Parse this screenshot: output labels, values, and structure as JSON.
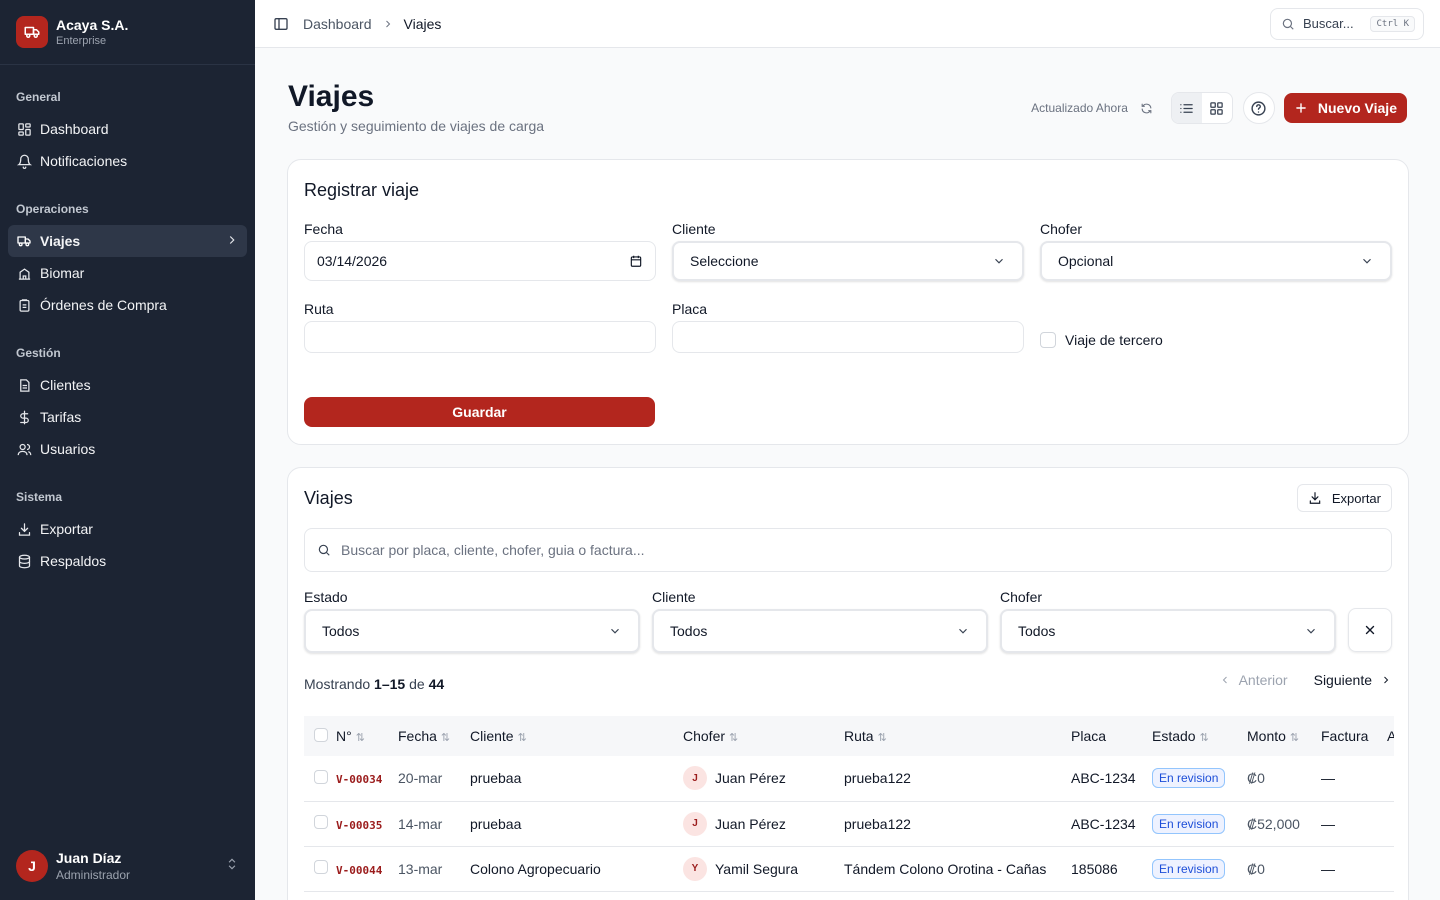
{
  "brand": {
    "name": "Acaya S.A.",
    "plan": "Enterprise"
  },
  "nav": [
    {
      "label": "General",
      "items": [
        {
          "label": "Dashboard",
          "icon": "grid-icon"
        },
        {
          "label": "Notificaciones",
          "icon": "bell-icon"
        }
      ]
    },
    {
      "label": "Operaciones",
      "items": [
        {
          "label": "Viajes",
          "icon": "truck-icon",
          "active": true
        },
        {
          "label": "Biomar",
          "icon": "building-icon"
        },
        {
          "label": "Órdenes de Compra",
          "icon": "clipboard-icon"
        }
      ]
    },
    {
      "label": "Gestión",
      "items": [
        {
          "label": "Clientes",
          "icon": "document-icon"
        },
        {
          "label": "Tarifas",
          "icon": "dollar-icon"
        },
        {
          "label": "Usuarios",
          "icon": "users-icon"
        }
      ]
    },
    {
      "label": "Sistema",
      "items": [
        {
          "label": "Exportar",
          "icon": "download-icon"
        },
        {
          "label": "Respaldos",
          "icon": "database-icon"
        }
      ]
    }
  ],
  "user": {
    "initial": "J",
    "name": "Juan Díaz",
    "role": "Administrador"
  },
  "topbar": {
    "breadcrumb": [
      "Dashboard",
      "Viajes"
    ],
    "search_label": "Buscar...",
    "search_shortcut": "Ctrl K"
  },
  "header": {
    "title": "Viajes",
    "subtitle": "Gestión y seguimiento de viajes de carga",
    "updated": "Actualizado Ahora",
    "new_button": "Nuevo Viaje"
  },
  "form": {
    "title": "Registrar viaje",
    "fecha_label": "Fecha",
    "fecha_value": "03/14/2026",
    "cliente_label": "Cliente",
    "cliente_value": "Seleccione",
    "chofer_label": "Chofer",
    "chofer_value": "Opcional",
    "ruta_label": "Ruta",
    "ruta_value": "",
    "placa_label": "Placa",
    "placa_value": "",
    "tercero_label": "Viaje de tercero",
    "save_button": "Guardar"
  },
  "list": {
    "title": "Viajes",
    "export_button": "Exportar",
    "search_placeholder": "Buscar por placa, cliente, chofer, guia o factura...",
    "filters": {
      "estado_label": "Estado",
      "estado_value": "Todos",
      "cliente_label": "Cliente",
      "cliente_value": "Todos",
      "chofer_label": "Chofer",
      "chofer_value": "Todos"
    },
    "showing_prefix": "Mostrando",
    "showing_range": "1–15",
    "showing_of": "de",
    "showing_total": "44",
    "prev_label": "Anterior",
    "next_label": "Siguiente",
    "columns": [
      "N°",
      "Fecha",
      "Cliente",
      "Chofer",
      "Ruta",
      "Placa",
      "Estado",
      "Monto",
      "Factura",
      "A"
    ],
    "rows": [
      {
        "code": "V-00034",
        "fecha": "20-mar",
        "cliente": "pruebaa",
        "chofer_initial": "J",
        "chofer": "Juan Pérez",
        "ruta": "prueba122",
        "placa": "ABC-1234",
        "estado": "En revision",
        "monto": "₡0",
        "factura": "—"
      },
      {
        "code": "V-00035",
        "fecha": "14-mar",
        "cliente": "pruebaa",
        "chofer_initial": "J",
        "chofer": "Juan Pérez",
        "ruta": "prueba122",
        "placa": "ABC-1234",
        "estado": "En revision",
        "monto": "₡52,000",
        "factura": "—"
      },
      {
        "code": "V-00044",
        "fecha": "13-mar",
        "cliente": "Colono Agropecuario",
        "chofer_initial": "Y",
        "chofer": "Yamil Segura",
        "ruta": "Tándem Colono Orotina - Cañas",
        "placa": "185086",
        "estado": "En revision",
        "monto": "₡0",
        "factura": "—"
      }
    ]
  },
  "colors": {
    "accent": "#b3261e",
    "sidebar": "#1c2433",
    "badge": "#1d4ed8"
  }
}
